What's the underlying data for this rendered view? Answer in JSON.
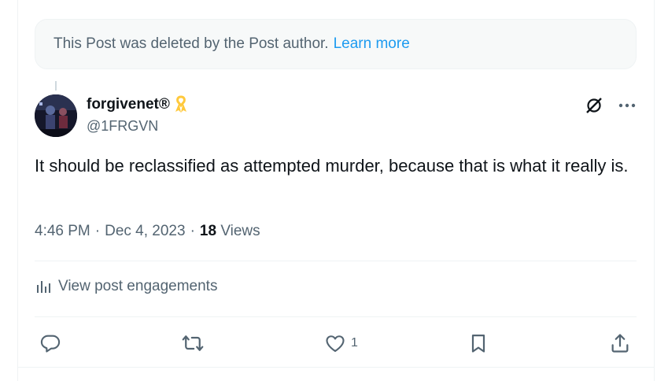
{
  "deleted_notice": {
    "text": "This Post was deleted by the Post author.",
    "link": "Learn more",
    "link_color": "#1d9bf0"
  },
  "post": {
    "display_name": "forgivenet®",
    "handle": "@1FRGVN",
    "badge_icon": "yellow-ribbon-icon",
    "text": "It should be reclassified as attempted murder, because that is what it really is.",
    "time": "4:46 PM",
    "date": "Dec 4, 2023",
    "separator": "·",
    "views_count": "18",
    "views_label": "Views"
  },
  "top_actions": {
    "grok_icon": "grok-icon",
    "more_icon": "more-icon"
  },
  "engagements": {
    "label": "View post engagements",
    "icon": "bar-chart-icon"
  },
  "actions": {
    "reply_count": "",
    "repost_count": "",
    "like_count": "1",
    "bookmark_count": "",
    "share_count": ""
  },
  "colors": {
    "text": "#0f1419",
    "secondary": "#536471",
    "border": "#eff3f4",
    "ribbon": "#ffc93c"
  }
}
